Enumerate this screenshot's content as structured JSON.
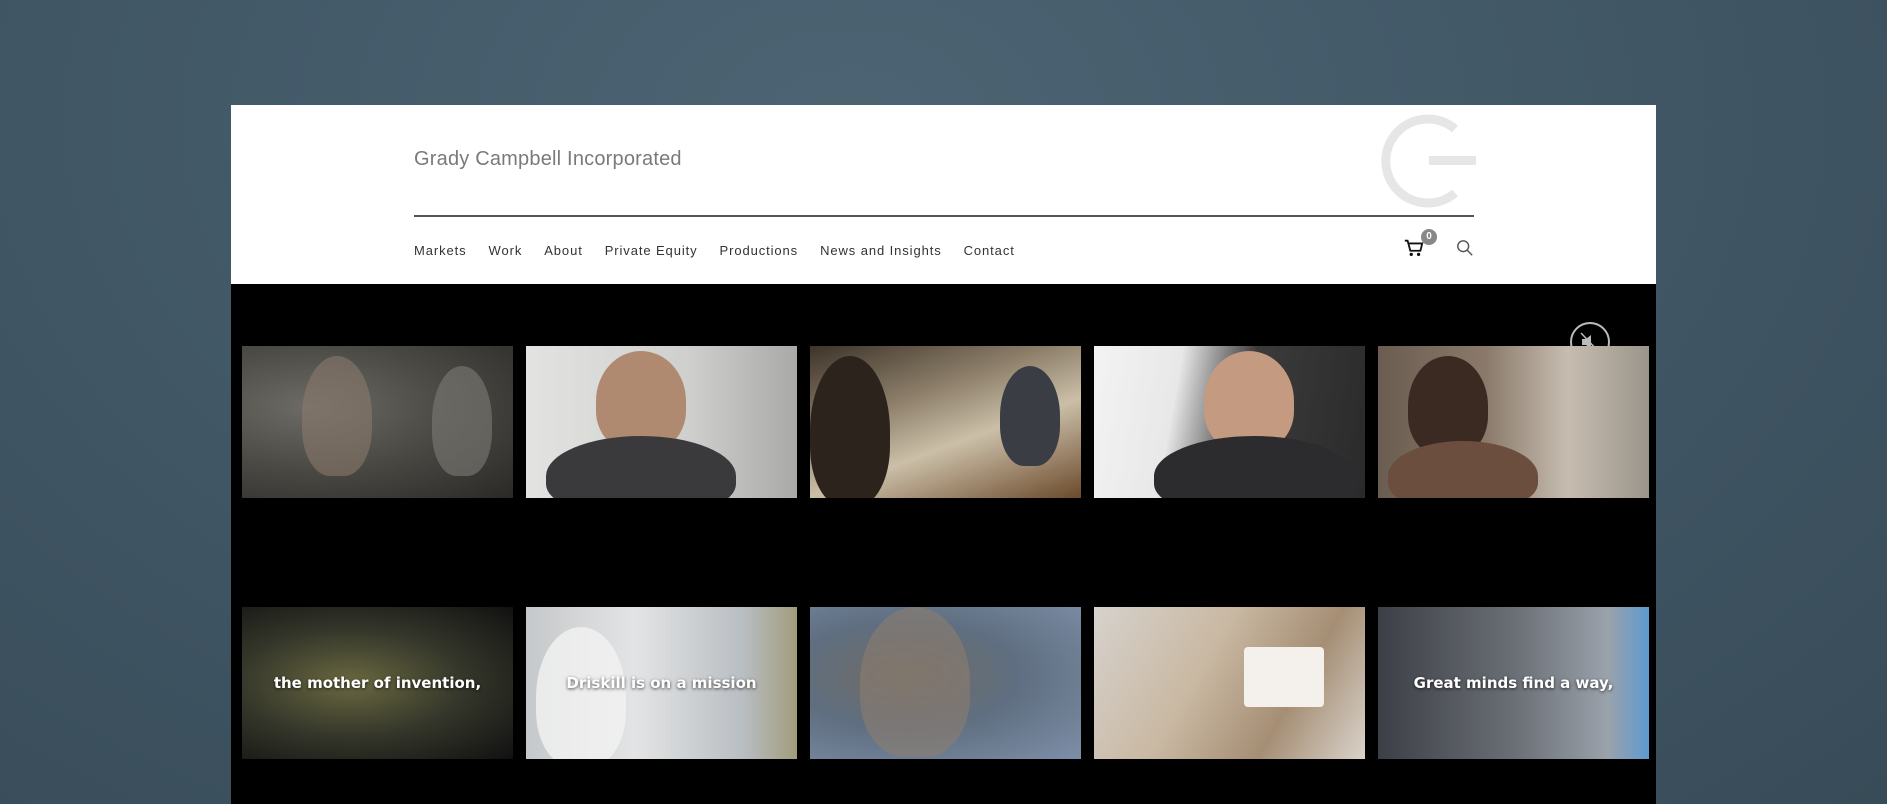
{
  "header": {
    "site_title": "Grady Campbell Incorporated",
    "logo_icon": "gc-monogram-icon",
    "cart_count": "0",
    "cart_icon": "cart-icon",
    "search_icon": "search-icon"
  },
  "nav": {
    "items": [
      {
        "label": "Markets"
      },
      {
        "label": "Work"
      },
      {
        "label": "About"
      },
      {
        "label": "Private Equity"
      },
      {
        "label": "Productions"
      },
      {
        "label": "News and Insights"
      },
      {
        "label": "Contact"
      }
    ]
  },
  "video": {
    "mute_icon": "mute-speaker-icon",
    "tiles_row1": [
      {
        "caption": ""
      },
      {
        "caption": ""
      },
      {
        "caption": ""
      },
      {
        "caption": ""
      },
      {
        "caption": ""
      }
    ],
    "tiles_row2": [
      {
        "caption": "the mother of invention,"
      },
      {
        "caption": "Driskill is on a mission"
      },
      {
        "caption": ""
      },
      {
        "caption": ""
      },
      {
        "caption": "Great minds find a way,"
      }
    ]
  },
  "colors": {
    "background": "#435a69",
    "header_bg": "#ffffff",
    "video_bg": "#000000",
    "title_text": "#7a7a7a",
    "nav_text": "#333333"
  }
}
